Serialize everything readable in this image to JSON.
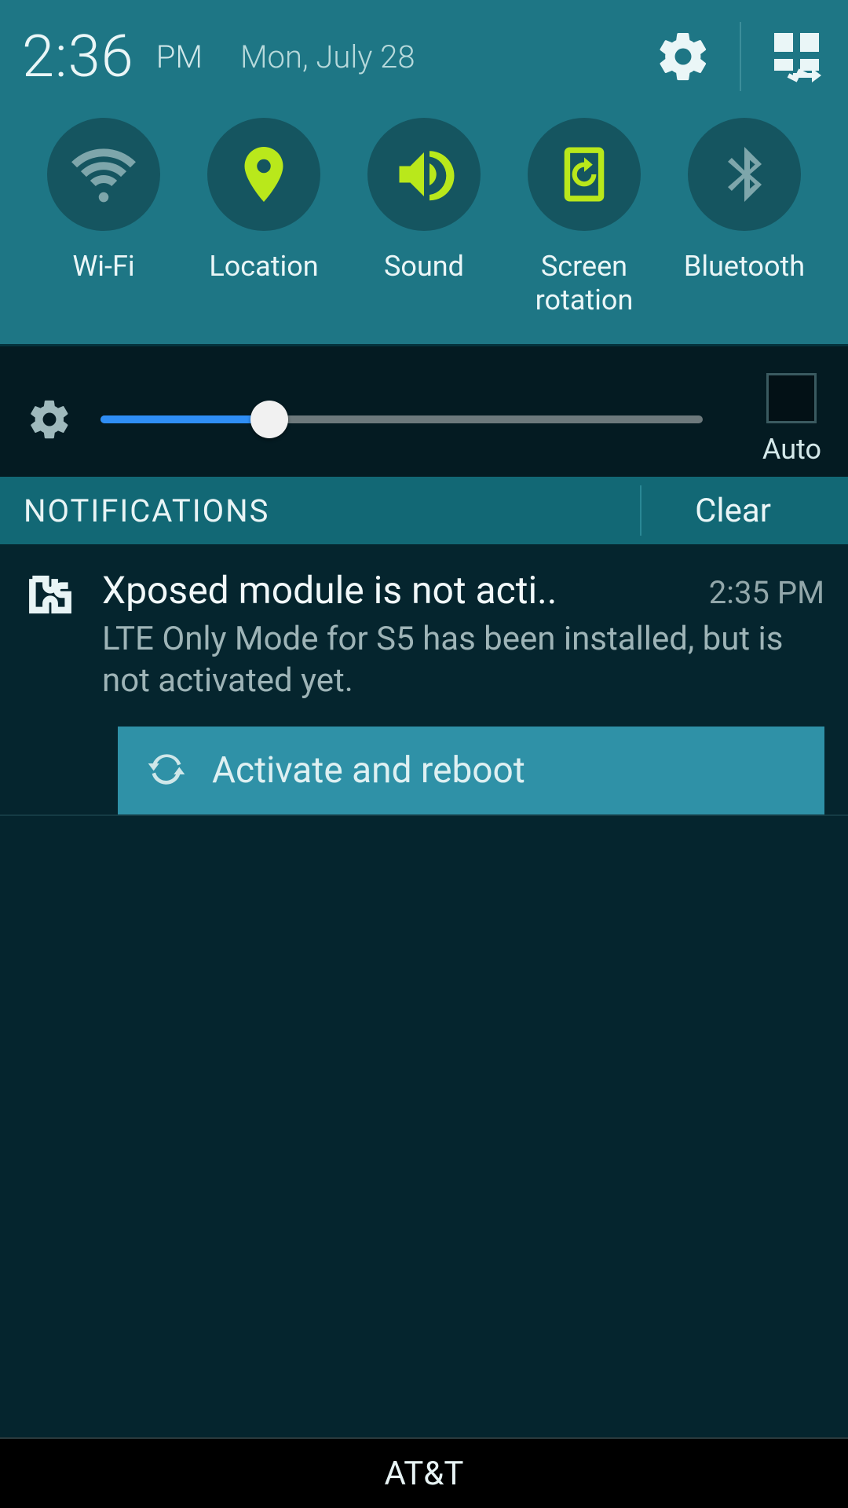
{
  "status": {
    "time": "2:36",
    "ampm": "PM",
    "date": "Mon, July 28",
    "settings_icon": "gear-icon",
    "panel_grid_icon": "panel-grid-icon"
  },
  "toggles": [
    {
      "id": "wifi",
      "label": "Wi-Fi",
      "active": false,
      "icon": "wifi-icon"
    },
    {
      "id": "location",
      "label": "Location",
      "active": true,
      "icon": "location-pin-icon"
    },
    {
      "id": "sound",
      "label": "Sound",
      "active": true,
      "icon": "speaker-icon"
    },
    {
      "id": "rotation",
      "label": "Screen\nrotation",
      "active": true,
      "icon": "rotation-icon"
    },
    {
      "id": "bluetooth",
      "label": "Bluetooth",
      "active": false,
      "icon": "bluetooth-icon"
    }
  ],
  "brightness": {
    "value_percent": 28,
    "auto_label": "Auto",
    "auto_checked": false
  },
  "section": {
    "title": "NOTIFICATIONS",
    "clear_label": "Clear"
  },
  "notifications": [
    {
      "icon": "puzzle-piece-icon",
      "title": "Xposed module is not acti..",
      "time": "2:35 PM",
      "description": "LTE Only Mode for S5 has been installed, but is not activated yet.",
      "action_icon": "refresh-icon",
      "action_label": "Activate and reboot"
    }
  ],
  "carrier": {
    "name": "AT&T"
  },
  "colors": {
    "header": "#1e7685",
    "accent": "#b9e81b",
    "action": "#2f91a7",
    "bg": "#05252e"
  }
}
